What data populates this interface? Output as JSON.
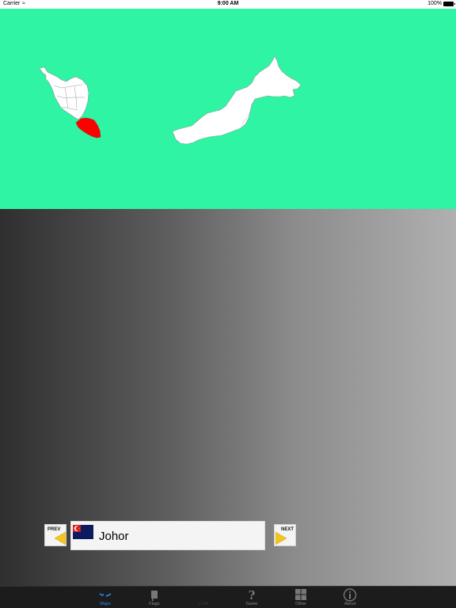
{
  "status_bar": {
    "carrier": "Carrier",
    "time": "9:00 AM",
    "battery": "100%"
  },
  "map": {
    "background_color": "#2ef4a4",
    "highlight_color": "#ff0000",
    "land_color": "#ffffff"
  },
  "navigation": {
    "prev_label": "PREV",
    "next_label": "NEXT",
    "accent_color": "#f2c61f"
  },
  "selected_state": {
    "name": "Johor",
    "flag_icon": "johor-flag-icon"
  },
  "tab_bar": {
    "tabs": [
      {
        "label": "Maps",
        "icon": "maps-icon",
        "active": true
      },
      {
        "label": "Flags",
        "icon": "flags-icon",
        "active": false
      },
      {
        "label": "COA",
        "icon": "coa-icon",
        "active": false
      },
      {
        "label": "Game",
        "icon": "question-icon",
        "active": false
      },
      {
        "label": "Other",
        "icon": "grid-icon",
        "active": false
      },
      {
        "label": "About",
        "icon": "info-icon",
        "active": false
      }
    ]
  }
}
